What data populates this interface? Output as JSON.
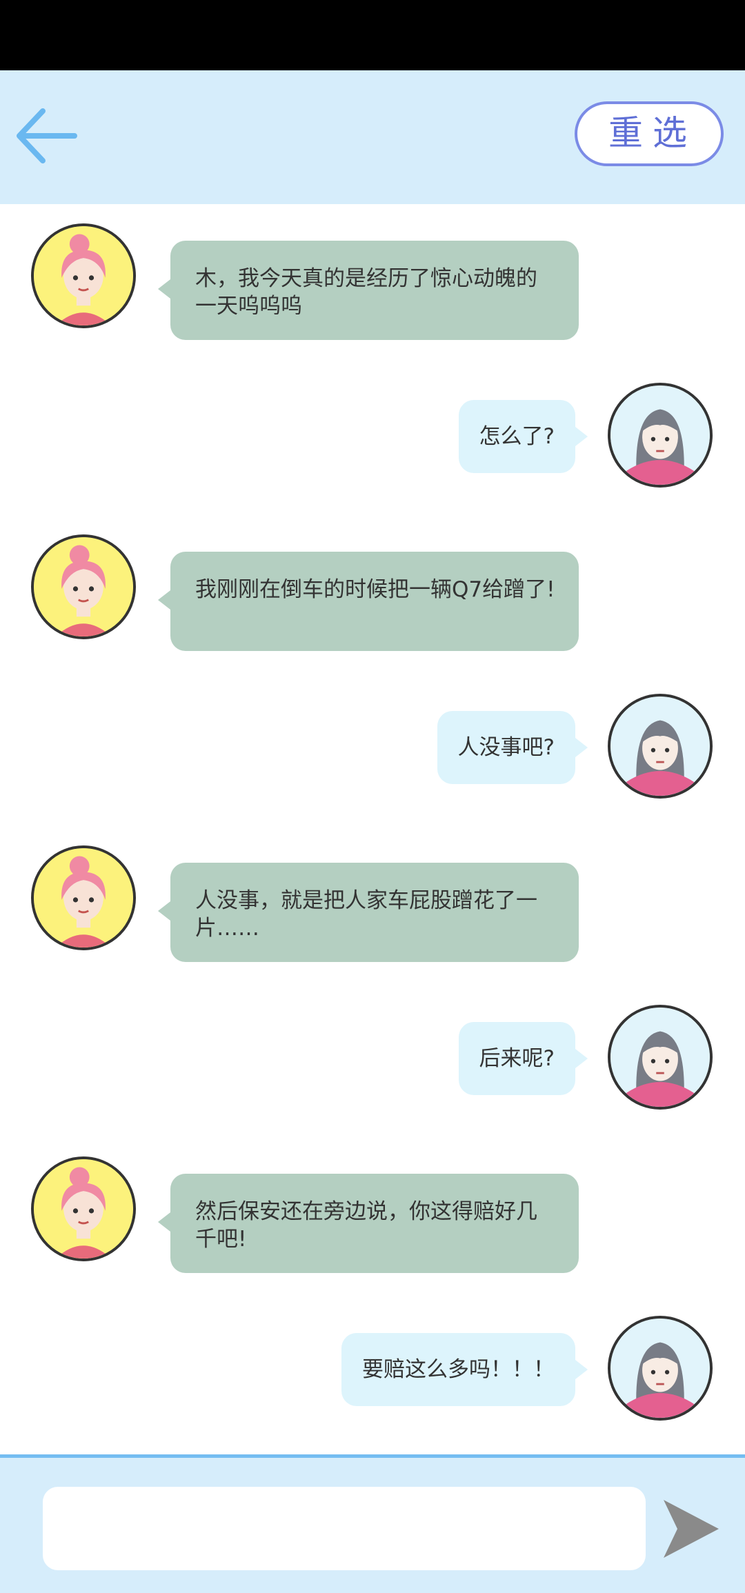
{
  "header": {
    "back_icon": "arrow-left-icon",
    "reselect_label": "重选",
    "accent_color": "#6ab8f0"
  },
  "messages": [
    {
      "side": "left",
      "text": "木，我今天真的是经历了惊心动魄的一天呜呜呜"
    },
    {
      "side": "right",
      "text": "怎么了?"
    },
    {
      "side": "left",
      "text": "我刚刚在倒车的时候把一辆Q7给蹭了!"
    },
    {
      "side": "right",
      "text": "人没事吧?"
    },
    {
      "side": "left",
      "text": "人没事，就是把人家车屁股蹭花了一片……"
    },
    {
      "side": "right",
      "text": "后来呢?"
    },
    {
      "side": "left",
      "text": "然后保安还在旁边说，你这得赔好几千吧!"
    },
    {
      "side": "right",
      "text": "要赔这么多吗！！！"
    }
  ],
  "composer": {
    "value": "",
    "placeholder": "",
    "send_icon": "send-icon"
  },
  "colors": {
    "header_bg": "#d6edfb",
    "left_bubble": "#b4cfc1",
    "right_bubble": "#ddf4fc",
    "left_avatar_bg": "#fcf27c"
  }
}
